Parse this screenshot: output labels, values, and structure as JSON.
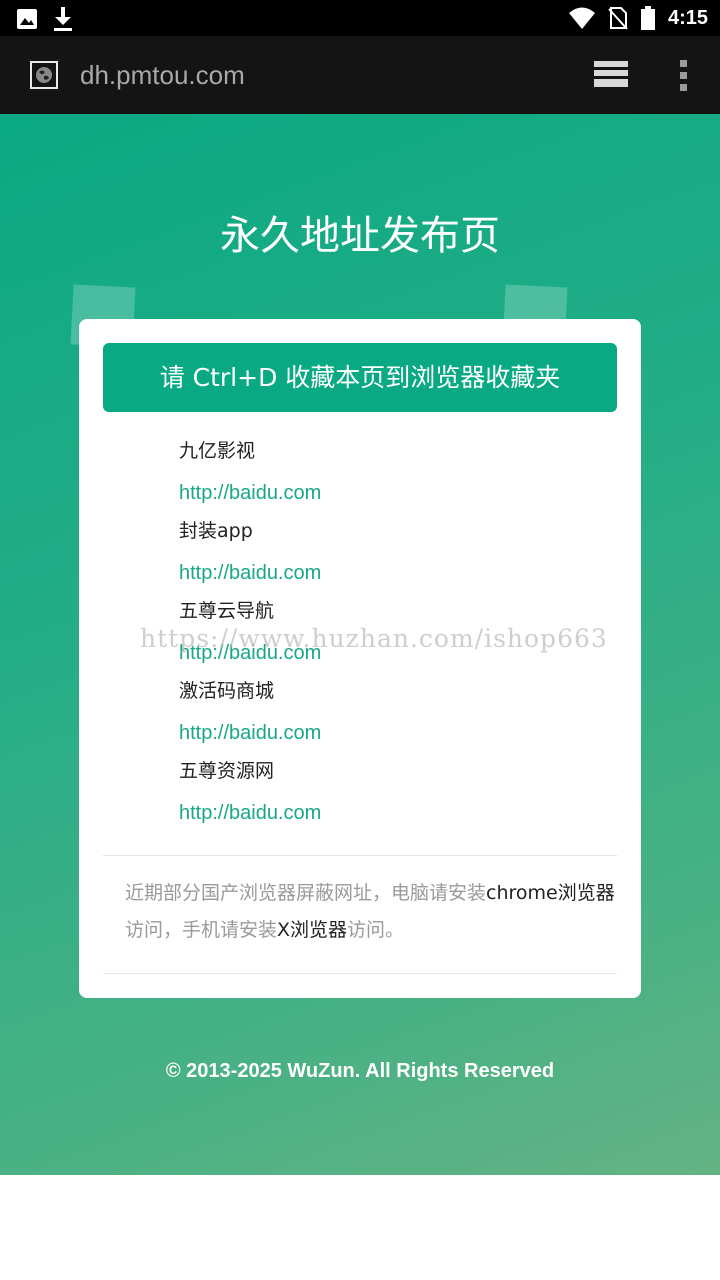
{
  "status_bar": {
    "time": "4:15",
    "icons": [
      "image-icon",
      "download-icon",
      "wifi-icon",
      "no-sim-icon",
      "battery-icon"
    ]
  },
  "browser": {
    "url": "dh.pmtou.com",
    "icons": [
      "site-globe-icon",
      "tabs-icon",
      "overflow-menu-icon"
    ]
  },
  "page": {
    "title": "永久地址发布页",
    "bookmark_hint": "请 Ctrl+D 收藏本页到浏览器收藏夹",
    "sites": [
      {
        "name": "九亿影视",
        "url": "http://baidu.com"
      },
      {
        "name": "封装app",
        "url": "http://baidu.com"
      },
      {
        "name": "五尊云导航",
        "url": "http://baidu.com"
      },
      {
        "name": "激活码商城",
        "url": "http://baidu.com"
      },
      {
        "name": "五尊资源网",
        "url": "http://baidu.com"
      }
    ],
    "notice": {
      "part1": "近期部分国产浏览器屏蔽网址，电脑请安装",
      "chrome": "chrome浏览器",
      "part2": "访问，手机请安装",
      "xbrowser": "X浏览器",
      "part3": "访问。"
    },
    "copyright": "© 2013-2025 WuZun. All Rights Reserved"
  },
  "watermark": "https://www.huzhan.com/ishop663",
  "colors": {
    "accent": "#08a983",
    "link": "#17a886",
    "toolbar": "#141414"
  }
}
